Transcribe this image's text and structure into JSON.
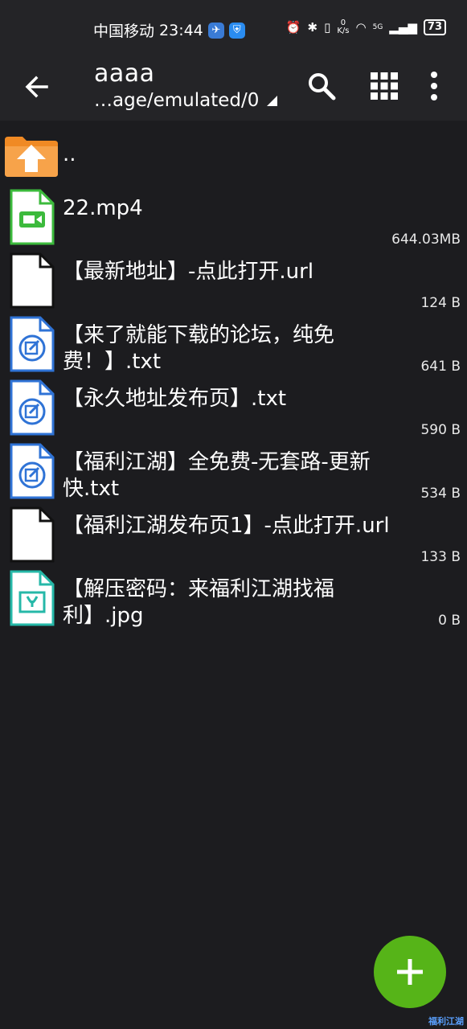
{
  "status_bar": {
    "carrier": "中国移动",
    "time": "23:44",
    "net_speed_value": "0",
    "net_speed_unit": "K/s",
    "network": "5G",
    "battery": "73"
  },
  "app_bar": {
    "title": "aaaa",
    "path": "…age/emulated/0"
  },
  "parent_label": "..",
  "files": [
    {
      "name": "22.mp4",
      "size": "644.03MB",
      "type": "video"
    },
    {
      "name": "【最新地址】-点此打开.url",
      "size": "124 B",
      "type": "blank"
    },
    {
      "name": "【来了就能下载的论坛，纯免费！】.txt",
      "size": "641 B",
      "type": "text"
    },
    {
      "name": "【永久地址发布页】.txt",
      "size": "590 B",
      "type": "text"
    },
    {
      "name": "【福利江湖】全免费-无套路-更新快.txt",
      "size": "534 B",
      "type": "text"
    },
    {
      "name": "【福利江湖发布页1】-点此打开.url",
      "size": "133 B",
      "type": "blank"
    },
    {
      "name": "【解压密码：来福利江湖找福利】.jpg",
      "size": "0 B",
      "type": "image"
    }
  ],
  "colors": {
    "background": "#1c1c1f",
    "bar": "#242427",
    "fab": "#56b418",
    "folder": "#f08a24",
    "video_icon": "#3cba3c",
    "text_icon": "#2f73d6",
    "image_icon": "#26b8a8"
  },
  "icons": {
    "back": "arrow-left-icon",
    "search": "search-icon",
    "grid": "grid-view-icon",
    "menu": "more-vert-icon",
    "fab": "plus-icon"
  },
  "watermark": "福利江湖"
}
